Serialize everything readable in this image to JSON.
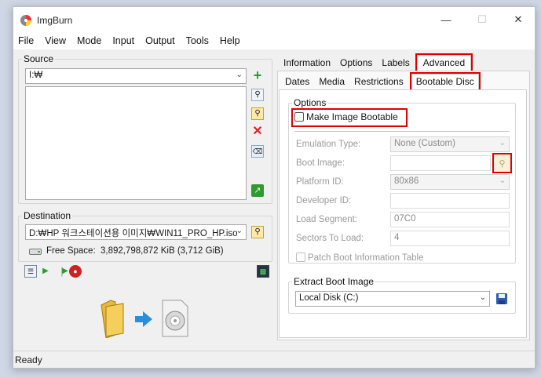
{
  "window": {
    "title": "ImgBurn",
    "minimize": "—",
    "maximize": "☐",
    "close": "✕"
  },
  "menu": [
    "File",
    "View",
    "Mode",
    "Input",
    "Output",
    "Tools",
    "Help"
  ],
  "source": {
    "legend": "Source",
    "drive": "I:₩"
  },
  "destination": {
    "legend": "Destination",
    "path": "D:₩HP 워크스테이션용 이미지₩WIN11_PRO_HP.iso",
    "free_space_label": "Free Space:",
    "free_space_value": "3,892,798,872 KiB  (3,712 GiB)"
  },
  "tabs_main": [
    "Information",
    "Options",
    "Labels",
    "Advanced"
  ],
  "tabs_sub": [
    "Dates",
    "Media",
    "Restrictions",
    "Bootable Disc"
  ],
  "options": {
    "legend": "Options",
    "make_bootable": "Make Image Bootable",
    "emulation_label": "Emulation Type:",
    "emulation_value": "None (Custom)",
    "boot_image_label": "Boot Image:",
    "boot_image_value": "",
    "platform_label": "Platform ID:",
    "platform_value": "80x86",
    "developer_label": "Developer ID:",
    "developer_value": "",
    "load_segment_label": "Load Segment:",
    "load_segment_value": "07C0",
    "sectors_label": "Sectors To Load:",
    "sectors_value": "4",
    "patch_label": "Patch Boot Information Table"
  },
  "extract": {
    "legend": "Extract Boot Image",
    "drive": "Local Disk (C:)"
  },
  "status": "Ready",
  "colors": {
    "highlight": "#e00000",
    "accent_green": "#2a9d2a"
  }
}
